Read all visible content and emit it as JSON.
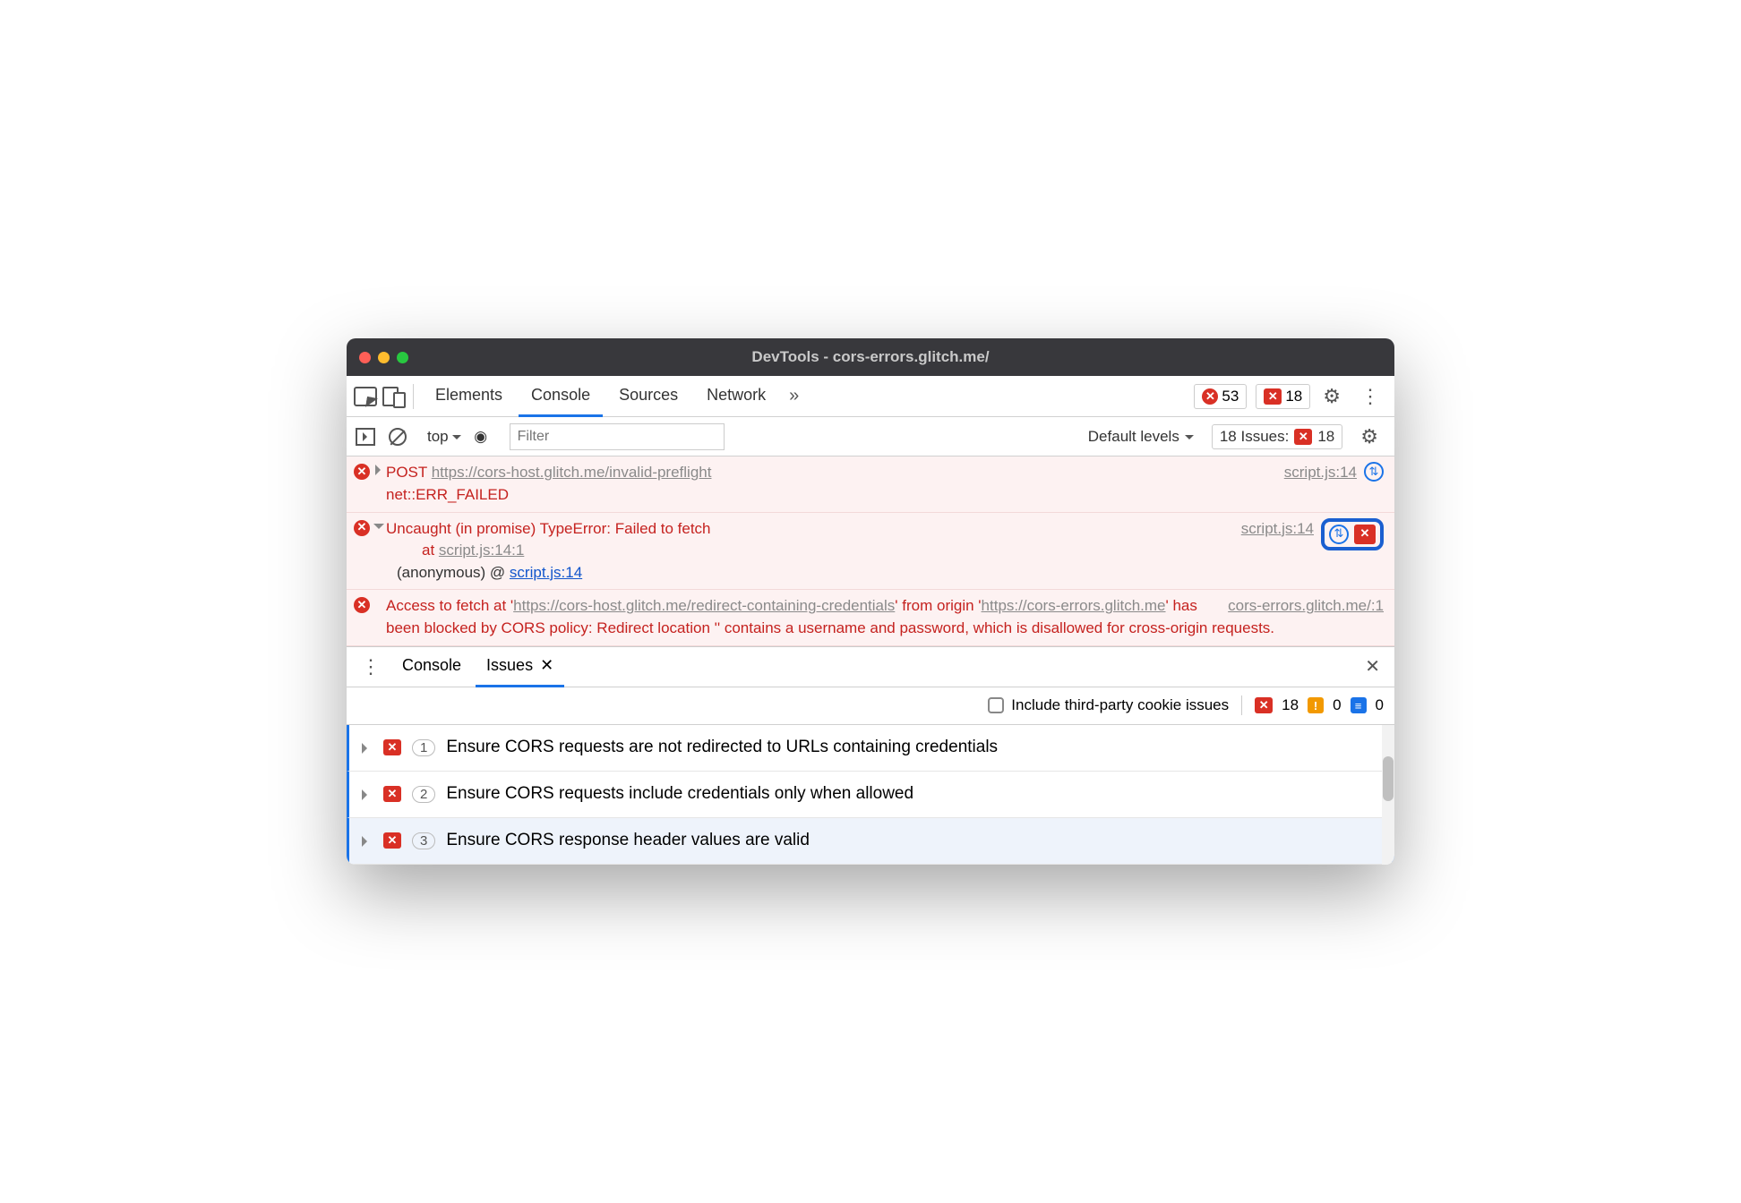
{
  "title": "DevTools - cors-errors.glitch.me/",
  "tabs": [
    "Elements",
    "Console",
    "Sources",
    "Network"
  ],
  "active_tab": "Console",
  "error_count": "53",
  "issue_count": "18",
  "console_toolbar": {
    "context": "top",
    "filter_placeholder": "Filter",
    "levels": "Default levels",
    "issues_label": "18 Issues:",
    "issues_n": "18"
  },
  "messages": [
    {
      "method": "POST",
      "url": "https://cors-host.glitch.me/invalid-preflight",
      "err": "net::ERR_FAILED",
      "src": "script.js:14"
    },
    {
      "headline": "Uncaught (in promise) TypeError: Failed to fetch",
      "at_pre": "at ",
      "at_link": "script.js:14:1",
      "anon": "(anonymous) @ ",
      "anon_link": "script.js:14",
      "src": "script.js:14"
    },
    {
      "text_a": "Access to fetch at '",
      "url1": "https://cors-host.glitch.me/redirect-containing-credentials",
      "text_b": "' from origin '",
      "url2": "https://cors-errors.glitch.me",
      "text_c": "' has been blocked by CORS policy: Redirect location '' contains a username and password, which is disallowed for cross-origin requests.",
      "src": "cors-errors.glitch.me/:1"
    }
  ],
  "drawer": {
    "tabs": [
      "Console",
      "Issues"
    ],
    "active": "Issues",
    "include_label": "Include third-party cookie issues",
    "counts": {
      "err": "18",
      "warn": "0",
      "info": "0"
    },
    "issues": [
      {
        "n": "1",
        "text": "Ensure CORS requests are not redirected to URLs containing credentials"
      },
      {
        "n": "2",
        "text": "Ensure CORS requests include credentials only when allowed"
      },
      {
        "n": "3",
        "text": "Ensure CORS response header values are valid"
      }
    ]
  }
}
